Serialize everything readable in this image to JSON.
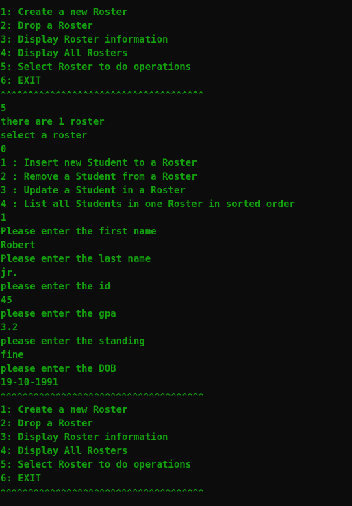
{
  "console": {
    "text_color": "#13a10e",
    "background": "#0c0c0c",
    "lines": [
      "1: Create a new Roster",
      "2: Drop a Roster",
      "3: Display Roster information",
      "4: Display All Rosters",
      "5: Select Roster to do operations",
      "6: EXIT",
      "^^^^^^^^^^^^^^^^^^^^^^^^^^^^^^^^^^^^^",
      "5",
      "there are 1 roster",
      "select a roster",
      "0",
      "1 : Insert new Student to a Roster",
      "2 : Remove a Student from a Roster",
      "3 : Update a Student in a Roster",
      "4 : List all Students in one Roster in sorted order",
      "1",
      "Please enter the first name",
      "Robert",
      "Please enter the last name",
      "jr.",
      "please enter the id",
      "45",
      "please enter the gpa",
      "3.2",
      "please enter the standing",
      "fine",
      "please enter the DOB",
      "19-10-1991",
      "^^^^^^^^^^^^^^^^^^^^^^^^^^^^^^^^^^^^^",
      "1: Create a new Roster",
      "2: Drop a Roster",
      "3: Display Roster information",
      "4: Display All Rosters",
      "5: Select Roster to do operations",
      "6: EXIT",
      "^^^^^^^^^^^^^^^^^^^^^^^^^^^^^^^^^^^^^"
    ]
  }
}
